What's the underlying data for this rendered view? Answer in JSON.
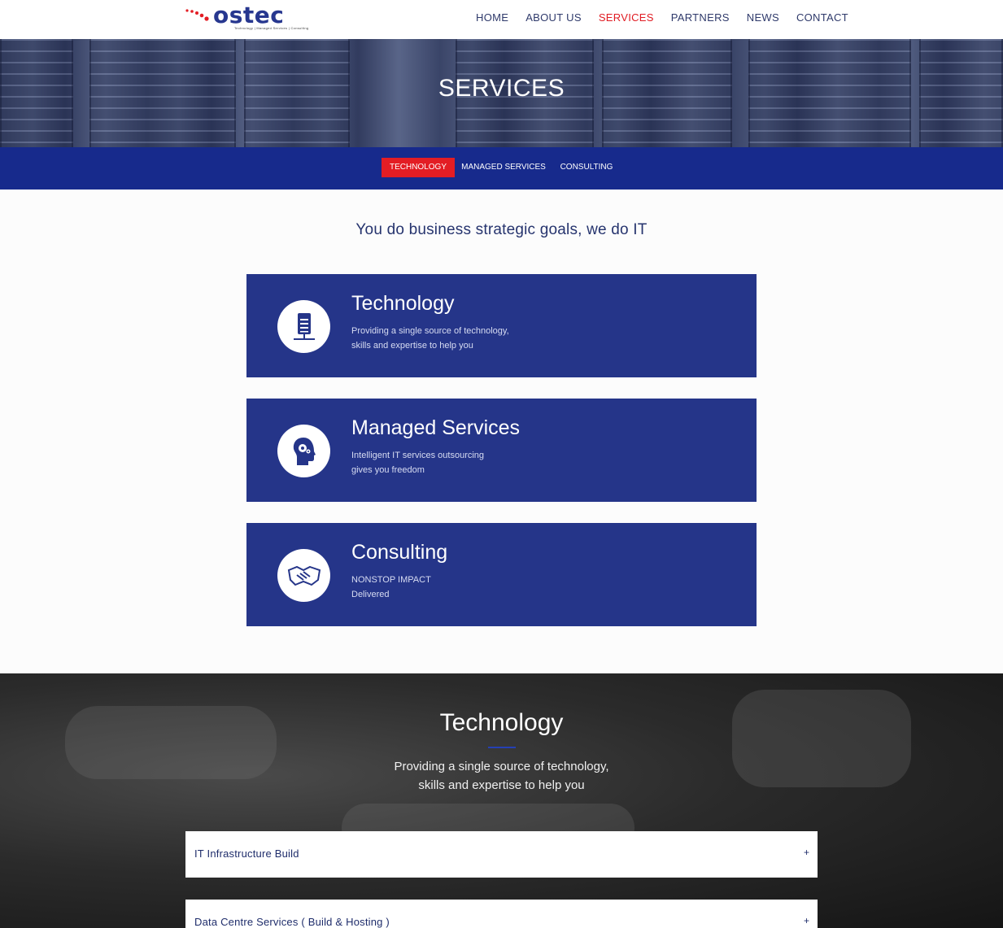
{
  "header": {
    "logo_text": "ostec",
    "logo_tagline": "Technology  |  Managed Services  |  Consulting",
    "nav": [
      {
        "label": "HOME",
        "active": false
      },
      {
        "label": "ABOUT US",
        "active": false
      },
      {
        "label": "SERVICES",
        "active": true
      },
      {
        "label": "PARTNERS",
        "active": false
      },
      {
        "label": "NEWS",
        "active": false
      },
      {
        "label": "CONTACT",
        "active": false
      }
    ]
  },
  "hero": {
    "title": "SERVICES"
  },
  "tabs": [
    {
      "label": "TECHNOLOGY",
      "active": true
    },
    {
      "label": "MANAGED SERVICES",
      "active": false
    },
    {
      "label": "CONSULTING",
      "active": false
    }
  ],
  "tagline": "You do business strategic goals, we do IT",
  "cards": [
    {
      "title": "Technology",
      "line1": "Providing a single source of technology,",
      "line2": "skills and expertise to help you",
      "icon": "server-icon"
    },
    {
      "title": "Managed Services",
      "line1": "Intelligent IT services outsourcing",
      "line2": "gives you freedom",
      "icon": "head-gear-icon"
    },
    {
      "title": "Consulting",
      "line1": "NONSTOP IMPACT",
      "line2": "Delivered",
      "icon": "handshake-icon"
    }
  ],
  "technology_section": {
    "title": "Technology",
    "desc_line1": "Providing a single source of technology,",
    "desc_line2": "skills and expertise to help you",
    "accordion": [
      {
        "label": "IT Infrastructure Build",
        "toggle": "+"
      },
      {
        "label": "Data Centre Services ( Build & Hosting )",
        "toggle": "+"
      }
    ]
  },
  "colors": {
    "brand_blue": "#253589",
    "tab_bar_blue": "#172a8c",
    "accent_red": "#e31d24"
  }
}
